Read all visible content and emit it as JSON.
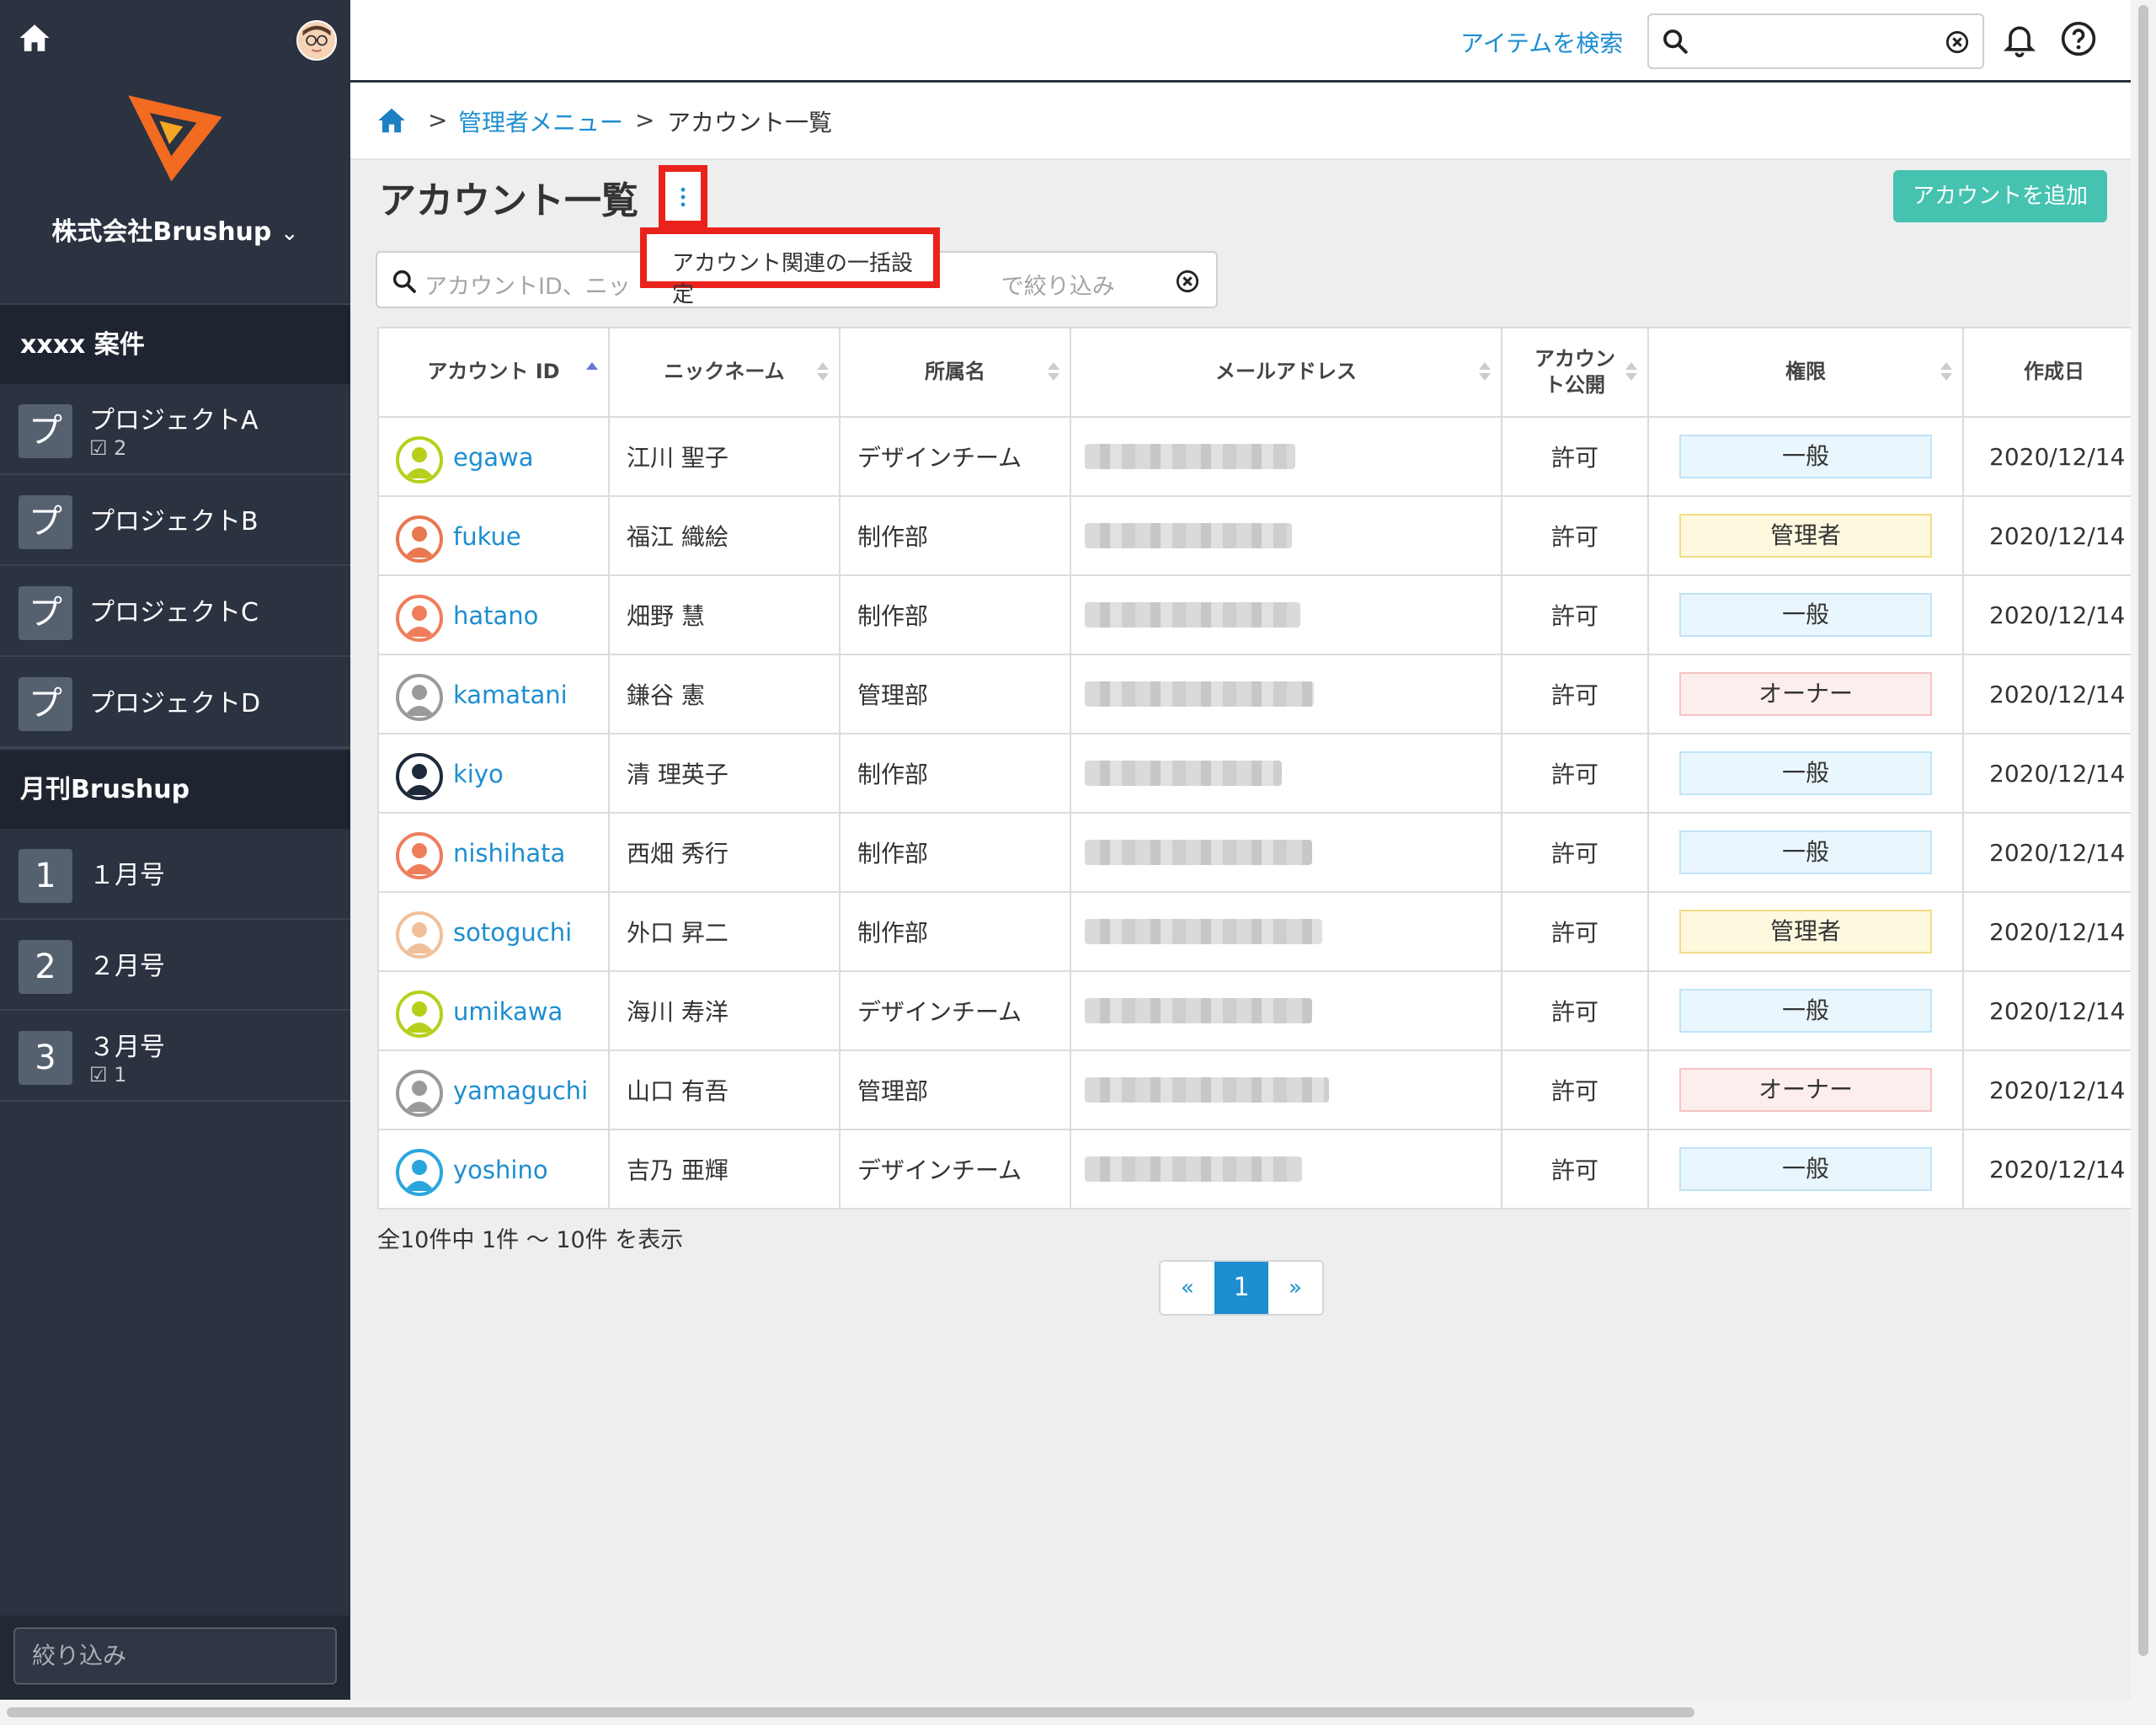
{
  "sidebar": {
    "company": "株式会社Brushup",
    "sections": [
      {
        "title": "xxxx 案件",
        "items": [
          {
            "badge": "プ",
            "label": "プロジェクトA",
            "sub": "2"
          },
          {
            "badge": "プ",
            "label": "プロジェクトB",
            "sub": ""
          },
          {
            "badge": "プ",
            "label": "プロジェクトC",
            "sub": ""
          },
          {
            "badge": "プ",
            "label": "プロジェクトD",
            "sub": ""
          }
        ]
      },
      {
        "title": "月刊Brushup",
        "items": [
          {
            "badge": "1",
            "label": "１月号",
            "sub": ""
          },
          {
            "badge": "2",
            "label": "２月号",
            "sub": ""
          },
          {
            "badge": "3",
            "label": "３月号",
            "sub": "1"
          }
        ]
      }
    ],
    "filter_placeholder": "絞り込み"
  },
  "topbar": {
    "search_label": "アイテムを検索",
    "search_value": ""
  },
  "breadcrumb": {
    "separator": ">",
    "link": "管理者メニュー",
    "current": "アカウント一覧"
  },
  "page": {
    "title": "アカウント一覧",
    "menu_item": "アカウント関連の一括設定",
    "add_button": "アカウントを追加",
    "filter_placeholder_left": "アカウントID、ニッ",
    "filter_placeholder_right": "で絞り込み"
  },
  "table": {
    "headers": {
      "account_id": "アカウント ID",
      "nickname": "ニックネーム",
      "department": "所属名",
      "email": "メールアドレス",
      "public_1": "アカウン",
      "public_2": "ト公開",
      "role": "権限",
      "created": "作成日"
    },
    "rows": [
      {
        "id": "egawa",
        "nickname": "江川 聖子",
        "dept": "デザインチーム",
        "public": "許可",
        "role": "一般",
        "created": "2020/12/14",
        "avatar_color": "#b7cf1b"
      },
      {
        "id": "fukue",
        "nickname": "福江 織絵",
        "dept": "制作部",
        "public": "許可",
        "role": "管理者",
        "created": "2020/12/14",
        "avatar_color": "#e9774f"
      },
      {
        "id": "hatano",
        "nickname": "畑野 慧",
        "dept": "制作部",
        "public": "許可",
        "role": "一般",
        "created": "2020/12/14",
        "avatar_color": "#ef7d5b"
      },
      {
        "id": "kamatani",
        "nickname": "鎌谷 憲",
        "dept": "管理部",
        "public": "許可",
        "role": "オーナー",
        "created": "2020/12/14",
        "avatar_color": "#9a9a9a"
      },
      {
        "id": "kiyo",
        "nickname": "清 理英子",
        "dept": "制作部",
        "public": "許可",
        "role": "一般",
        "created": "2020/12/14",
        "avatar_color": "#1e2a3a"
      },
      {
        "id": "nishihata",
        "nickname": "西畑 秀行",
        "dept": "制作部",
        "public": "許可",
        "role": "一般",
        "created": "2020/12/14",
        "avatar_color": "#ef7d5b"
      },
      {
        "id": "sotoguchi",
        "nickname": "外口 昇二",
        "dept": "制作部",
        "public": "許可",
        "role": "管理者",
        "created": "2020/12/14",
        "avatar_color": "#f0c09a"
      },
      {
        "id": "umikawa",
        "nickname": "海川 寿洋",
        "dept": "デザインチーム",
        "public": "許可",
        "role": "一般",
        "created": "2020/12/14",
        "avatar_color": "#b7cf1b"
      },
      {
        "id": "yamaguchi",
        "nickname": "山口 有吾",
        "dept": "管理部",
        "public": "許可",
        "role": "オーナー",
        "created": "2020/12/14",
        "avatar_color": "#9a9a9a"
      },
      {
        "id": "yoshino",
        "nickname": "吉乃 亜輝",
        "dept": "デザインチーム",
        "public": "許可",
        "role": "一般",
        "created": "2020/12/14",
        "avatar_color": "#2aa6dd"
      }
    ]
  },
  "summary": "全10件中 1件 〜 10件 を表示",
  "pagination": {
    "prev": "«",
    "current": "1",
    "next": "»"
  },
  "colors": {
    "sidebar_bg": "#2b3240",
    "link": "#1d8ed0",
    "add_button": "#45c3b0",
    "highlight": "#e9231c"
  }
}
